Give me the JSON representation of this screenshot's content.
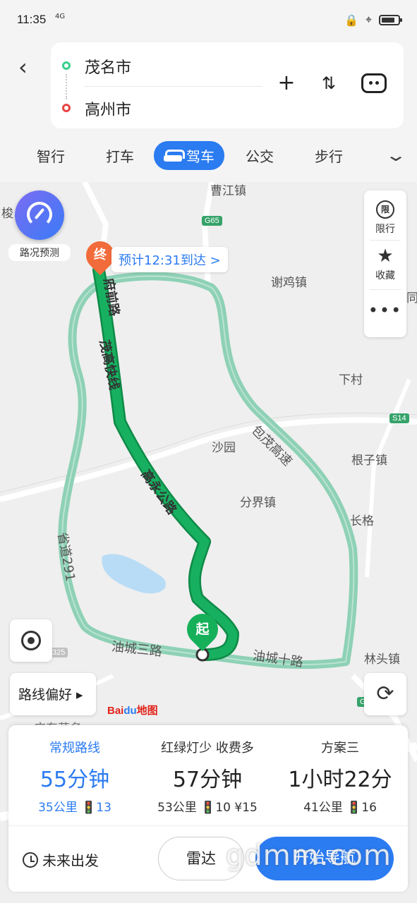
{
  "status": {
    "time": "11:35",
    "signal": "4G"
  },
  "route": {
    "from": "茂名市",
    "to": "高州市"
  },
  "modes": [
    "智行",
    "打车",
    "驾车",
    "公交",
    "步行"
  ],
  "active_mode": "驾车",
  "map": {
    "traffic_forecast_label": "路况预测",
    "eta_label": "预计12:31到达 >",
    "end_marker": "终",
    "start_marker": "起",
    "tools": {
      "limit_icon": "限",
      "limit": "限行",
      "favorite": "收藏"
    },
    "place_labels": [
      "曹江镇",
      "谢鸡镇",
      "下村",
      "沙园",
      "根子镇",
      "分界镇",
      "长格",
      "林头镇",
      "广东茂名",
      "梭",
      "同"
    ],
    "road_labels": [
      "府前路",
      "茂高快线",
      "高永公路",
      "包茂高速",
      "省道291",
      "油城三路",
      "油城十路"
    ],
    "shields": [
      "G65",
      "S14",
      "325",
      "G"
    ],
    "route_pref": "路线偏好 ▸",
    "logo": {
      "bai": "Bai",
      "du": "du",
      "map": "地图"
    }
  },
  "plans": [
    {
      "title": "常规路线",
      "time": "55分钟",
      "meta": "35公里 🚦13"
    },
    {
      "title": "红绿灯少 收费多",
      "time": "57分钟",
      "meta": "53公里 🚦10 ¥15"
    },
    {
      "title": "方案三",
      "time": "1小时22分",
      "meta": "41公里 🚦16"
    }
  ],
  "actions": {
    "future": "未来出发",
    "radar": "雷达",
    "start": "开始导航"
  },
  "watermark": "gdmm.com",
  "colors": {
    "accent": "#2b7bf1",
    "route_main": "#17b060",
    "route_alt": "#8ed1b6"
  }
}
